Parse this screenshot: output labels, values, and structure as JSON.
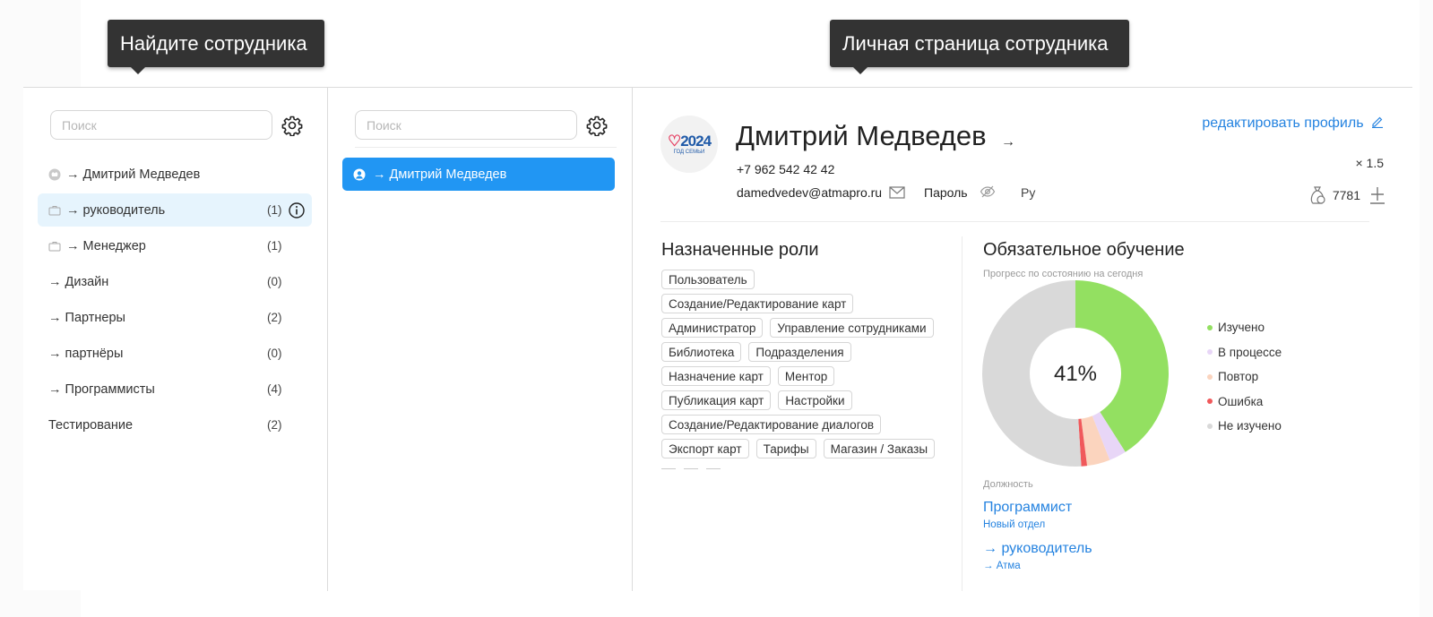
{
  "callouts": {
    "find_employee": "Найдите сотрудника",
    "personal_page": "Личная страница сотрудника"
  },
  "departments_panel": {
    "search_placeholder": "Поиск",
    "items": [
      {
        "label": "→ Дмитрий Медведев",
        "count": "",
        "icon": "user-circle-icon"
      },
      {
        "label": "→ руководитель",
        "count": "(1)",
        "icon": "briefcase-icon"
      },
      {
        "label": "→ Менеджер",
        "count": "(1)",
        "icon": "briefcase-icon"
      },
      {
        "label": "→ Дизайн",
        "count": "(0)",
        "icon": ""
      },
      {
        "label": "→ Партнеры",
        "count": "(2)",
        "icon": ""
      },
      {
        "label": "→ партнёры",
        "count": "(0)",
        "icon": ""
      },
      {
        "label": "→ Программисты",
        "count": "(4)",
        "icon": ""
      },
      {
        "label": "Тестирование",
        "count": "(2)",
        "icon": ""
      }
    ]
  },
  "employees_panel": {
    "search_placeholder": "Поиск",
    "selected_employee": "→ Дмитрий Медведев"
  },
  "profile": {
    "avatar_text_big": "2024",
    "avatar_text_small": "ГОД СЕМЬИ",
    "name": "Дмитрий Медведев",
    "name_suffix": "→",
    "phone": "+7 962 542 42 42",
    "email": "damedvedev@atmapro.ru",
    "password_label": "Пароль",
    "language": "Ру",
    "edit_profile": "редактировать профиль",
    "multiplier": "× 1.5",
    "coins": "7781"
  },
  "roles": {
    "title": "Назначенные роли",
    "rows": [
      [
        "Пользователь"
      ],
      [
        "Создание/Редактирование карт"
      ],
      [
        "Администратор",
        "Управление сотрудниками"
      ],
      [
        "Библиотека",
        "Подразделения"
      ],
      [
        "Назначение карт",
        "Ментор"
      ],
      [
        "Публикация карт",
        "Настройки"
      ],
      [
        "Создание/Редактирование диалогов"
      ],
      [
        "Экспорт карт",
        "Тарифы",
        "Магазин / Заказы"
      ]
    ]
  },
  "education": {
    "title": "Обязательное обучение",
    "subtitle": "Прогресс по состоянию на сегодня",
    "percent_label": "41%"
  },
  "position": {
    "label": "Должность",
    "title": "Программист",
    "department": "Новый отдел",
    "manager": "→ руководитель",
    "manager_sub": "→ Атма"
  },
  "colors": {
    "accent": "#2196f3",
    "link": "#2583e0",
    "active_row": "#e6f4fd"
  },
  "chart_data": {
    "type": "pie",
    "categories": [
      "Изучено",
      "В процессе",
      "Повтор",
      "Ошибка",
      "Не изучено"
    ],
    "values": [
      41,
      3,
      4,
      1,
      51
    ],
    "colors": [
      "#93e061",
      "#e8d6f7",
      "#fbd4be",
      "#f0595b",
      "#d9d9d9"
    ],
    "center_label": "41%",
    "legend": "right"
  }
}
